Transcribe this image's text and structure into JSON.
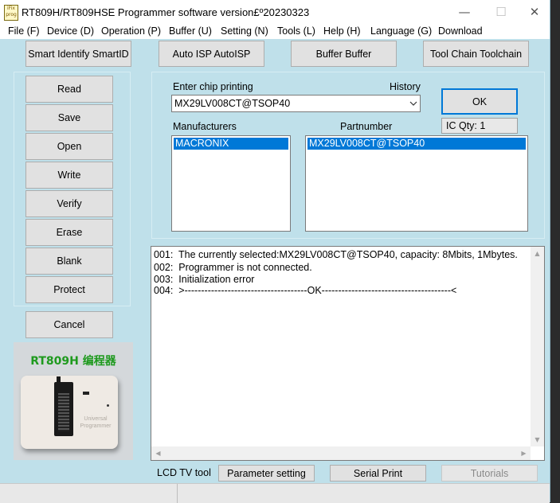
{
  "window": {
    "title": "RT809H/RT809HSE Programmer software version£º20230323",
    "icon_text": "iFix prog",
    "controls": {
      "minimize": "—",
      "maximize": "☐",
      "close": "✕"
    }
  },
  "menu": [
    "File (F)",
    "Device (D)",
    "Operation (P)",
    "Buffer (U)",
    "Setting (N)",
    "Tools (L)",
    "Help (H)",
    "Language (G)",
    "Download"
  ],
  "toolbar": {
    "smart_identify": "Smart Identify SmartID",
    "auto_isp": "Auto ISP AutoISP",
    "buffer": "Buffer Buffer",
    "tool_chain": "Tool Chain Toolchain"
  },
  "sidebar": {
    "buttons": [
      "Read",
      "Save",
      "Open",
      "Write",
      "Verify",
      "Erase",
      "Blank",
      "Protect"
    ],
    "cancel": "Cancel",
    "product_label": "RT809H 编程器",
    "product_device_text": "Universal Programmer"
  },
  "chip": {
    "enter_label": "Enter chip printing",
    "history_label": "History",
    "value": "MX29LV008CT@TSOP40",
    "ok": "OK",
    "ic_qty": "IC Qty: 1",
    "manufacturers_label": "Manufacturers",
    "partnumber_label": "Partnumber",
    "manufacturers": [
      "MACRONIX"
    ],
    "partnumbers": [
      "MX29LV008CT@TSOP40"
    ]
  },
  "log": [
    "001:  The currently selected:MX29LV008CT@TSOP40, capacity: 8Mbits, 1Mbytes.",
    "002:  Programmer is not connected.",
    "003:  Initialization error",
    "004:  >-------------------------------------OK---------------------------------------<"
  ],
  "bottom": {
    "lcd_tv_tool": "LCD TV tool",
    "parameter_setting": "Parameter setting",
    "serial_print": "Serial Print",
    "tutorials": "Tutorials"
  },
  "colors": {
    "background": "#bfe0ea",
    "selection": "#0078d7",
    "product_label": "#1e9a1e"
  }
}
